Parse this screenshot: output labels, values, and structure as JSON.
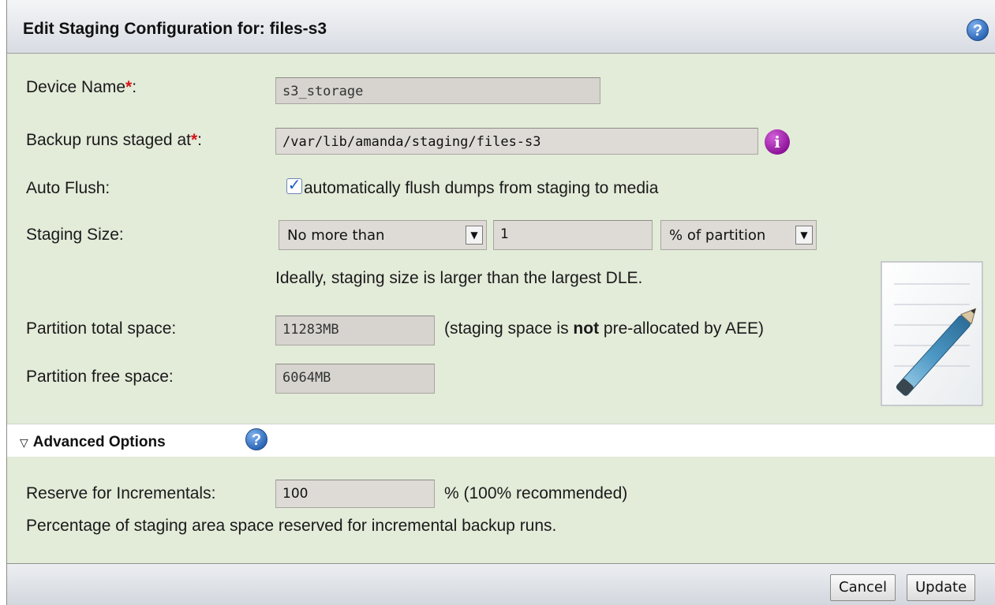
{
  "dialog": {
    "title": "Edit Staging Configuration for: files-s3",
    "help_icon": "question-icon"
  },
  "device_name": {
    "label": "Device Name",
    "required_mark": "*",
    "suffix": ":",
    "value": "s3_storage"
  },
  "staged_at": {
    "label": "Backup runs staged at",
    "required_mark": "*",
    "suffix": ":",
    "value": "/var/lib/amanda/staging/files-s3",
    "info_icon": "info-icon",
    "info_glyph": "i"
  },
  "auto_flush": {
    "label": "Auto Flush:",
    "checked": true,
    "check_glyph": "✓",
    "checkbox_text": "automatically flush dumps from staging to media"
  },
  "staging_size": {
    "label": "Staging Size:",
    "limit_select": "No more than",
    "amount": "1",
    "unit_select": "% of partition",
    "arrow_glyph": "▼",
    "hint": "Ideally, staging size is larger than the largest DLE."
  },
  "partition_total": {
    "label": "Partition total space:",
    "value": "11283MB",
    "note_prefix": "(staging space is ",
    "note_bold": "not",
    "note_suffix": " pre-allocated by AEE)"
  },
  "partition_free": {
    "label": "Partition free space:",
    "value": "6064MB"
  },
  "advanced": {
    "toggle_glyph": "▽",
    "label": "Advanced Options",
    "help_glyph": "?"
  },
  "reserve": {
    "label": "Reserve for Incrementals:",
    "value": "100",
    "suffix": "% (100% recommended)",
    "description": "Percentage of staging area space reserved for incremental backup runs."
  },
  "footer": {
    "cancel_label": "Cancel",
    "update_label": "Update"
  },
  "colors": {
    "panel_bg": "#e3ebd9",
    "required": "#d4141a",
    "help_blue": "#2f69b8",
    "info_purple": "#8a0f95"
  }
}
